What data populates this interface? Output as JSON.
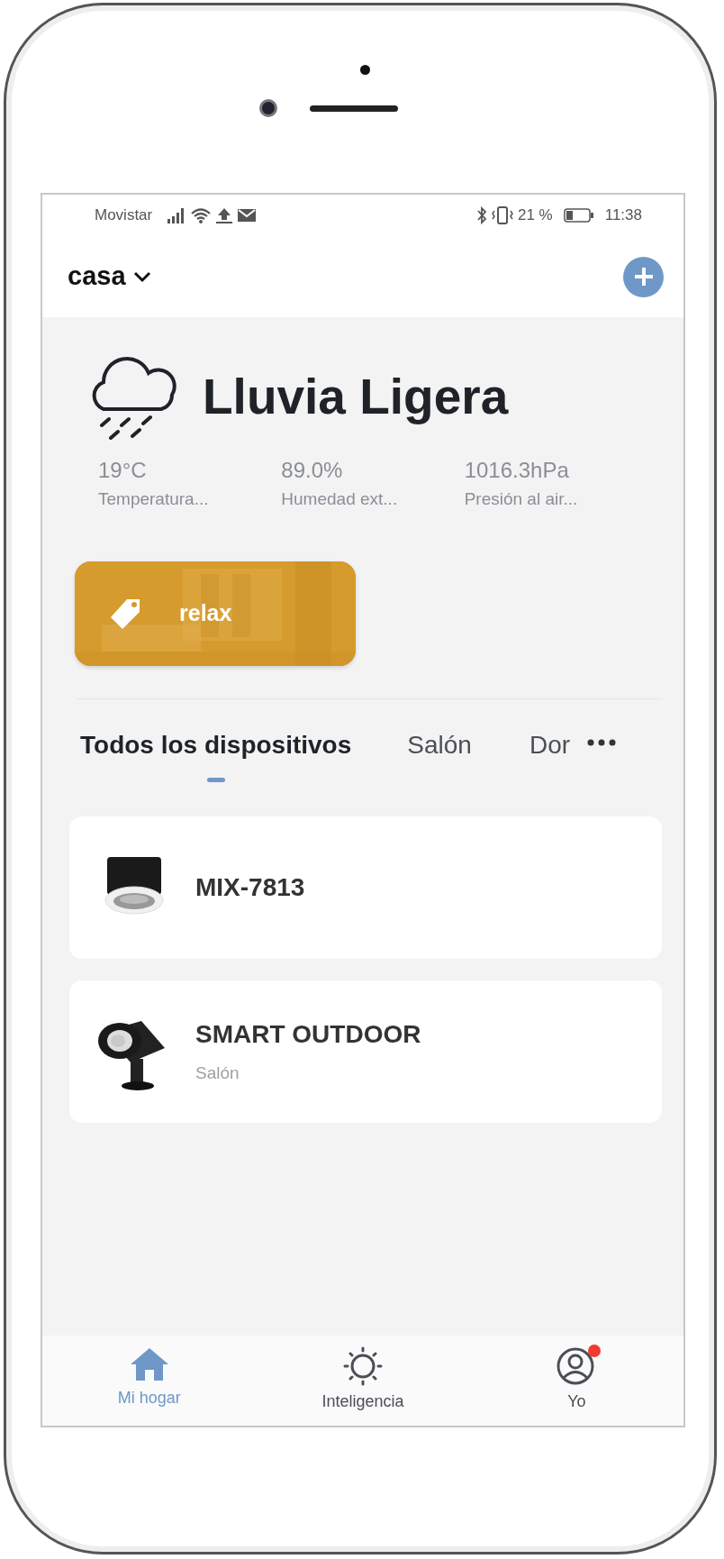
{
  "status_bar": {
    "carrier": "Movistar",
    "battery_text": "21 %",
    "time": "11:38"
  },
  "header": {
    "home": "casa"
  },
  "weather": {
    "condition": "Lluvia Ligera",
    "stats": [
      {
        "value": "19°C",
        "label": "Temperatura..."
      },
      {
        "value": "89.0%",
        "label": "Humedad ext..."
      },
      {
        "value": "1016.3hPa",
        "label": "Presión al air..."
      }
    ]
  },
  "scenes": [
    {
      "name": "relax",
      "color": "#d69b2d"
    }
  ],
  "tabs": [
    {
      "label": "Todos los dispositivos",
      "selected": true
    },
    {
      "label": "Salón",
      "selected": false
    },
    {
      "label": "Dor",
      "selected": false
    }
  ],
  "devices": [
    {
      "name": "MIX-7813",
      "kind": "downlight"
    },
    {
      "name": "SMART OUTDOOR",
      "room": "Salón",
      "kind": "spotlight"
    }
  ],
  "bottom_nav": [
    {
      "label": "Mi hogar",
      "kind": "home",
      "selected": true,
      "notification": false
    },
    {
      "label": "Inteligencia",
      "kind": "sun",
      "selected": false,
      "notification": false
    },
    {
      "label": "Yo",
      "kind": "user",
      "selected": false,
      "notification": true
    }
  ]
}
